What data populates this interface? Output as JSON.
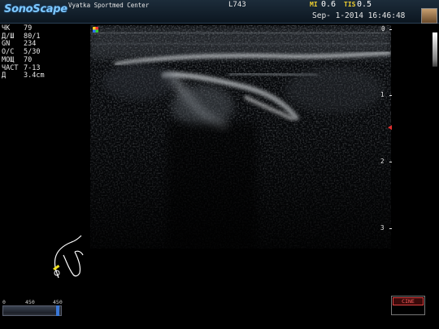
{
  "header": {
    "logo": "SonoScape",
    "hospital": "Vyatka Sportmed Center",
    "probe": "L743",
    "mi_label": "MI",
    "mi_value": "0.6",
    "tis_label": "TIS",
    "tis_value": "0.5",
    "datetime": "Sep- 1-2014 16:46:48"
  },
  "parameters": [
    {
      "key": "ЧК",
      "value": "79"
    },
    {
      "key": "Д/Ш",
      "value": "80/1"
    },
    {
      "key": "GN",
      "value": "234"
    },
    {
      "key": "О/С",
      "value": "5/30"
    },
    {
      "key": "МОЩ",
      "value": "70"
    },
    {
      "key": "ЧАСТ",
      "value": "7-13"
    },
    {
      "key": "Д",
      "value": "3.4cm"
    }
  ],
  "depth_scale": [
    "0",
    "1",
    "2",
    "3"
  ],
  "cine_slider": {
    "min_label": "0",
    "mid_label": "450",
    "max_label": "450",
    "position": 1.0
  },
  "cine_button": "CINE",
  "colors": {
    "logo": "#7ec8ff",
    "mi_tis_label": "#f0d030",
    "focus_marker": "#e03030",
    "cine": "#ff6060"
  }
}
